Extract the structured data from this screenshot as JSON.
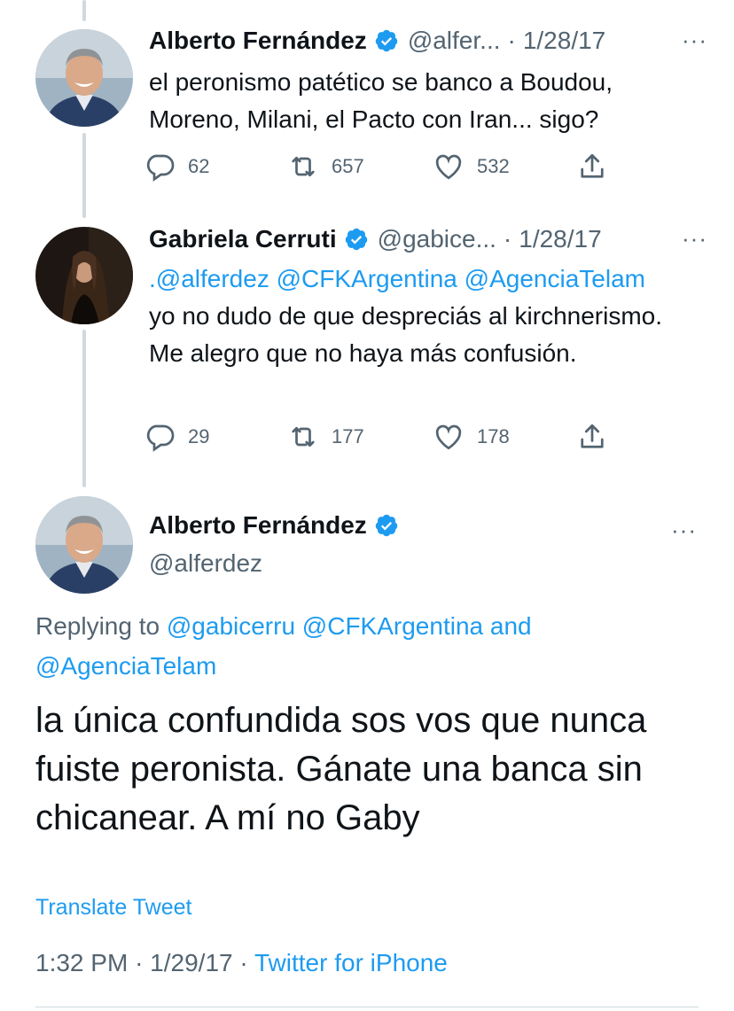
{
  "thread": [
    {
      "name": "Alberto Fernández",
      "handle": "@alfer...",
      "separator": "·",
      "date": "1/28/17",
      "more": "···",
      "text": "el peronismo patético se banco a Boudou, Moreno, Milani, el Pacto con Iran... sigo?",
      "actions": {
        "replies": "62",
        "retweets": "657",
        "likes": "532"
      }
    },
    {
      "name": "Gabriela Cerruti",
      "handle": "@gabice...",
      "separator": "·",
      "date": "1/28/17",
      "more": "···",
      "mentions_line": ".@alferdez @CFKArgentina @AgenciaTelam",
      "text": "yo no dudo de que despreciás al kirchnerismo. Me alegro que no haya más confusión.",
      "actions": {
        "replies": "29",
        "retweets": "177",
        "likes": "178"
      }
    }
  ],
  "main": {
    "name": "Alberto Fernández",
    "handle": "@alferdez",
    "more": "···",
    "replying_prefix": "Replying to",
    "replying_mentions": "@gabicerru @CFKArgentina and @AgenciaTelam",
    "text": "la única confundida sos vos que nunca fuiste peronista. Gánate una banca sin chicanear. A mí no Gaby",
    "translate": "Translate Tweet",
    "time": "1:32 PM",
    "separator": "·",
    "date": "1/29/17",
    "separator2": "·",
    "source": "Twitter for iPhone"
  },
  "colors": {
    "accent": "#1d9bf0",
    "secondary_text": "#536471",
    "primary_text": "#0f1419",
    "thread_line": "#cfd9de"
  }
}
